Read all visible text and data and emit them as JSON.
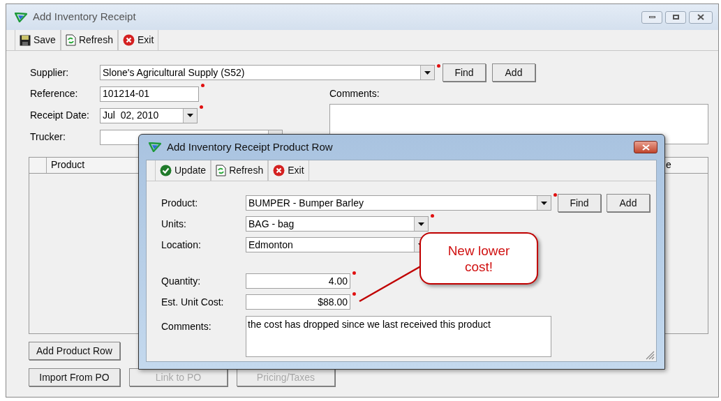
{
  "main_window": {
    "title": "Add Inventory Receipt",
    "toolbar": [
      {
        "kind": "save",
        "label": "Save"
      },
      {
        "kind": "refresh",
        "label": "Refresh"
      },
      {
        "kind": "exit",
        "label": "Exit"
      }
    ],
    "supplier": {
      "label": "Supplier:",
      "value": "Slone's Agricultural Supply (S52)",
      "required": true
    },
    "supplier_buttons": [
      "Find",
      "Add"
    ],
    "fields": [
      {
        "kind": "text",
        "label": "Reference:",
        "value": "101214-01",
        "required": true
      },
      {
        "kind": "combo",
        "label": "Receipt Date:",
        "value": "Jul  02, 2010",
        "required": true
      },
      {
        "kind": "combo",
        "label": "Trucker:",
        "required": false
      }
    ],
    "comments": {
      "label": "Comments:"
    },
    "table": {
      "columns": [
        "Product",
        "e"
      ]
    },
    "buttons": [
      {
        "label": "Add Product Row",
        "disabled": false
      },
      {
        "label": "Import From PO",
        "disabled": false
      },
      {
        "label": "Link to PO",
        "disabled": true
      },
      {
        "label": "Pricing/Taxes",
        "disabled": true
      }
    ]
  },
  "dialog": {
    "title": "Add Inventory Receipt Product Row",
    "toolbar": [
      {
        "kind": "update",
        "label": "Update"
      },
      {
        "kind": "refresh",
        "label": "Refresh"
      },
      {
        "kind": "exit",
        "label": "Exit"
      }
    ],
    "product_buttons": [
      "Find",
      "Add"
    ],
    "fields": [
      {
        "kind": "combo",
        "label": "Product:",
        "value": "BUMPER - Bumper Barley",
        "required": true
      },
      {
        "kind": "combo",
        "label": "Units:",
        "value": "BAG - bag",
        "required": true
      },
      {
        "kind": "combo",
        "label": "Location:",
        "value": "Edmonton",
        "required": false
      },
      {
        "kind": "number",
        "label": "Quantity:",
        "value": "4.00",
        "required": true
      },
      {
        "kind": "number",
        "label": "Est. Unit Cost:",
        "value": "$88.00",
        "required": true
      },
      {
        "kind": "textarea",
        "label": "Comments:",
        "value": "the cost has dropped since we last received this product",
        "required": false
      }
    ]
  },
  "callout": {
    "text": "New lower cost!"
  }
}
